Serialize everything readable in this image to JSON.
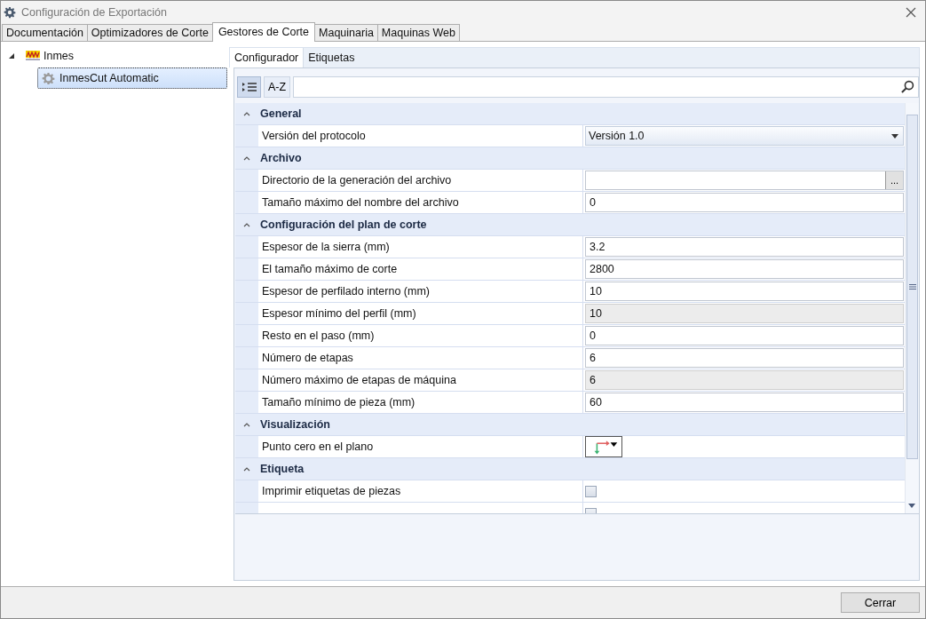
{
  "window": {
    "title": "Configuración de Exportación"
  },
  "tabs": [
    {
      "label": "Documentación",
      "selected": false
    },
    {
      "label": "Optimizadores de Corte",
      "selected": false
    },
    {
      "label": "Gestores de Corte",
      "selected": true
    },
    {
      "label": "Maquinaria",
      "selected": false
    },
    {
      "label": "Maquinas Web",
      "selected": false
    }
  ],
  "tree": [
    {
      "label": "Inmes",
      "expanded": true,
      "selected": false,
      "children": [
        {
          "label": "InmesCut Automatic",
          "selected": true
        }
      ]
    }
  ],
  "inner_tabs": [
    {
      "label": "Configurador",
      "selected": true
    },
    {
      "label": "Etiquetas",
      "selected": false
    }
  ],
  "toolbar": {
    "sort_buttons": [
      {
        "kind": "categorized",
        "selected": true
      },
      {
        "kind": "alphabetical",
        "label": "A-Z",
        "selected": false
      }
    ]
  },
  "categories": [
    {
      "name": "General",
      "expanded": true,
      "properties": [
        {
          "kind": "combo",
          "label": "Versión del protocolo",
          "value": "Versión 1.0"
        }
      ]
    },
    {
      "name": "Archivo",
      "expanded": true,
      "properties": [
        {
          "kind": "browse",
          "label": "Directorio de la generación del archivo",
          "browse_label": "..."
        },
        {
          "kind": "text",
          "label": "Tamaño máximo del nombre del archivo",
          "value": "0"
        }
      ]
    },
    {
      "name": "Configuración del plan de corte",
      "expanded": true,
      "properties": [
        {
          "kind": "text",
          "label": "Espesor de la sierra (mm)",
          "value": "3.2"
        },
        {
          "kind": "text",
          "label": "El tamaño máximo de corte",
          "value": "2800"
        },
        {
          "kind": "text",
          "label": "Espesor de perfilado interno (mm)",
          "value": "10"
        },
        {
          "kind": "readonly",
          "label": "Espesor mínimo del perfil (mm)",
          "value": "10"
        },
        {
          "kind": "text",
          "label": "Resto en el paso (mm)",
          "value": "0"
        },
        {
          "kind": "text",
          "label": "Número de etapas",
          "value": "6"
        },
        {
          "kind": "readonly",
          "label": "Número máximo de etapas de máquina",
          "value": "6"
        },
        {
          "kind": "text",
          "label": "Tamaño mínimo de pieza (mm)",
          "value": "60"
        }
      ]
    },
    {
      "name": "Visualización",
      "expanded": true,
      "properties": [
        {
          "kind": "origin",
          "label": "Punto cero en el plano"
        }
      ]
    },
    {
      "name": "Etiqueta",
      "expanded": true,
      "properties": [
        {
          "kind": "checkbox",
          "label": "Imprimir etiquetas de piezas",
          "checked": false
        },
        {
          "kind": "checkbox",
          "checked": false
        }
      ]
    }
  ],
  "buttons": [
    {
      "label": "Cerrar"
    }
  ]
}
